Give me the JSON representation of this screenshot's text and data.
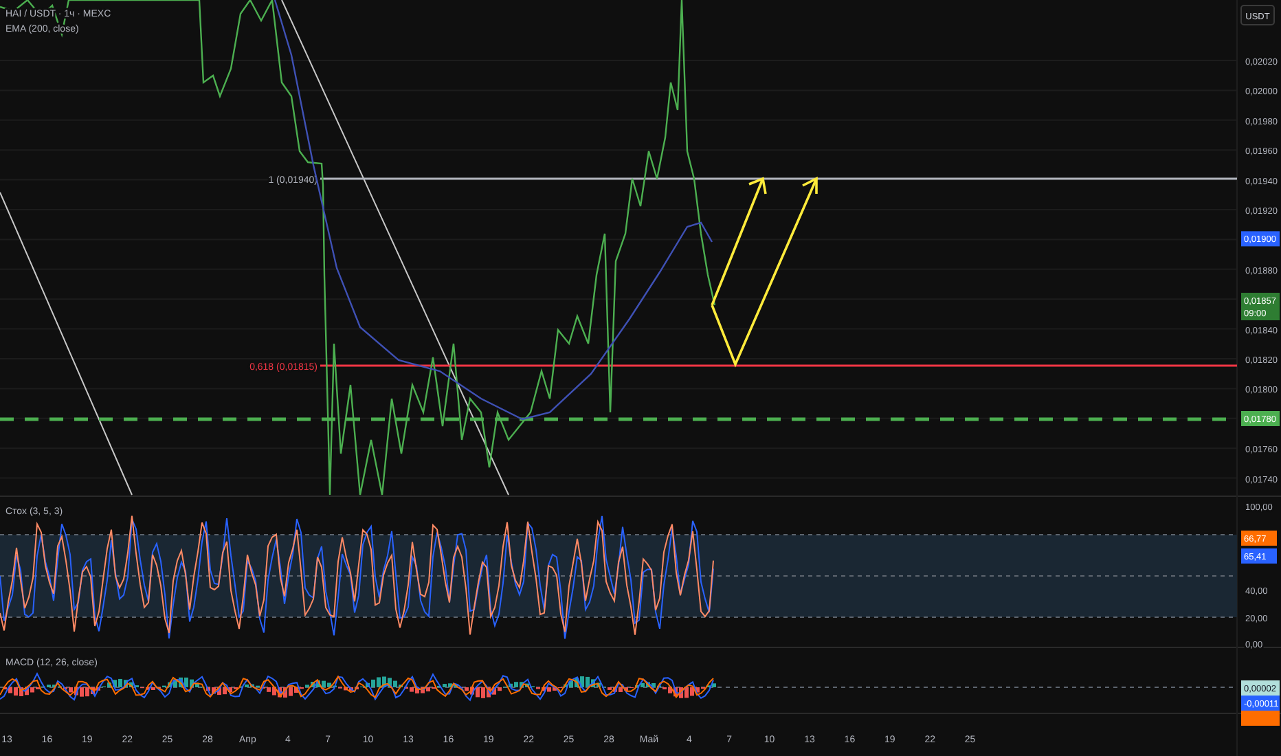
{
  "legend": {
    "symbol": "HAI / USDT · 1ч · MEXC",
    "ema": "EMA (200, close)"
  },
  "currency_button": "USDT",
  "price_axis": {
    "labels": [
      "0,02020",
      "0,02000",
      "0,01980",
      "0,01960",
      "0,01940",
      "0,01920",
      "0,01880",
      "0,01840",
      "0,01820",
      "0,01800",
      "0,01760",
      "0,01740"
    ],
    "ema_badge": "0,01900",
    "current_price": "0,01857",
    "countdown": "09:00",
    "level_badge": "0,01780"
  },
  "fib_levels": [
    {
      "label": "1 (0,01940)",
      "color": "#b2b5be"
    },
    {
      "label": "0,618 (0,01815)",
      "color": "#f23645"
    }
  ],
  "stoch": {
    "legend": "Стох (3, 5, 3)",
    "labels": [
      "100,00",
      "40,00",
      "20,00",
      "0,00"
    ],
    "k_badge": "66,77",
    "d_badge": "65,41"
  },
  "macd": {
    "legend": "MACD (12, 26, close)",
    "badges": [
      {
        "text": "0,00002",
        "kind": "histogram"
      },
      {
        "text": "-0,00011",
        "kind": "macd"
      },
      {
        "kind": "signal"
      }
    ]
  },
  "time_axis": [
    "13",
    "16",
    "19",
    "22",
    "25",
    "28",
    "Апр",
    "4",
    "7",
    "10",
    "13",
    "16",
    "19",
    "22",
    "25",
    "28",
    "Май",
    "4",
    "7",
    "10",
    "13",
    "16",
    "19",
    "22",
    "25"
  ]
}
